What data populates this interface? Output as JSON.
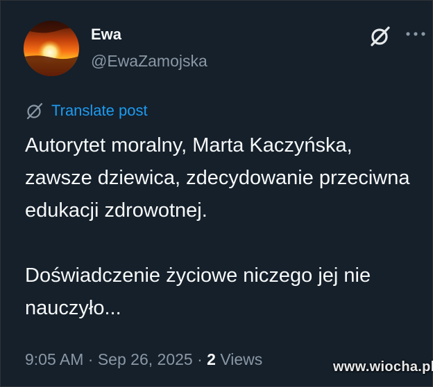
{
  "author": {
    "display_name": "Ewa",
    "handle": "@EwaZamojska",
    "avatar_icon": "sunset-avatar"
  },
  "header_icons": {
    "grok": "grok-icon",
    "more": "more-options-icon"
  },
  "translate": {
    "label": "Translate post",
    "icon": "translate-icon"
  },
  "post": {
    "paragraph_1": "Autorytet moralny, Marta Kaczyńska, zawsze dziewica, zdecydowanie przeciwna edukacji zdrowotnej.",
    "paragraph_2": "Doświadczenie życiowe niczego jej nie nauczyło..."
  },
  "meta": {
    "time": "9:05 AM",
    "separator": "·",
    "date": "Sep 26, 2025",
    "views_count": "2",
    "views_label": "Views"
  },
  "watermark": "www.wiocha.pl",
  "colors": {
    "background": "#15202b",
    "text": "#f7f9f9",
    "secondary": "#8b98a5",
    "accent": "#1d9bf0"
  }
}
